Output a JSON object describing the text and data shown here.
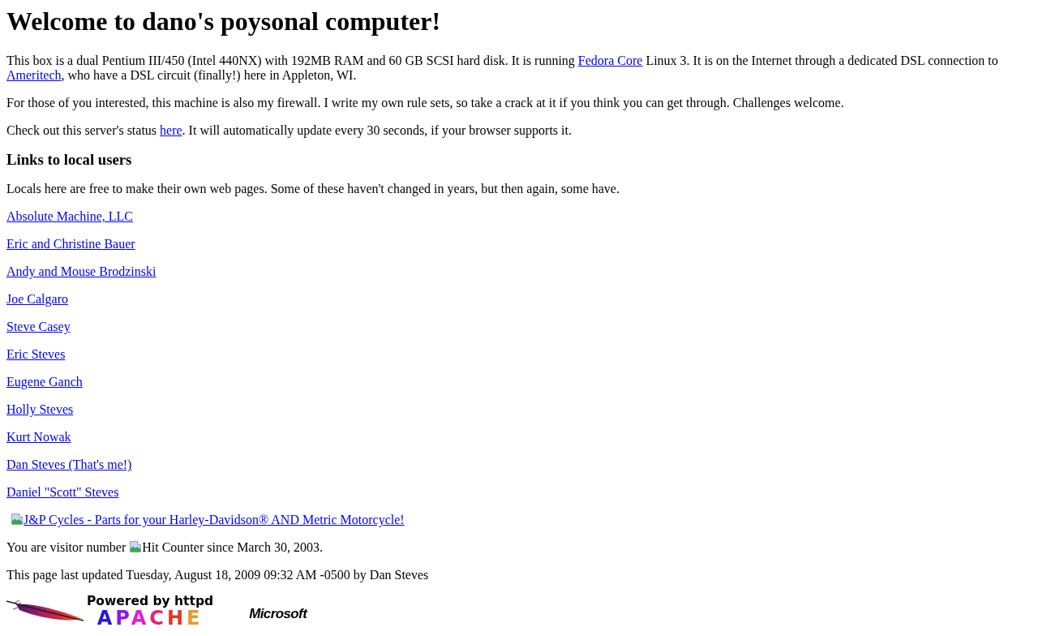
{
  "title": "Welcome to dano's poysonal computer!",
  "intro": [
    {
      "parts": [
        {
          "kind": "text",
          "text": "This box is a dual Pentium III/450 (Intel 440NX) with 192MB RAM and 60 GB SCSI hard disk. It is running "
        },
        {
          "kind": "link",
          "text": "Fedora Core"
        },
        {
          "kind": "text",
          "text": " Linux 3. It is on the Internet through a dedicated DSL connection to "
        },
        {
          "kind": "link",
          "text": "Ameritech"
        },
        {
          "kind": "text",
          "text": ", who have a DSL circuit (finally!) here in Appleton, WI."
        }
      ]
    },
    {
      "parts": [
        {
          "kind": "text",
          "text": "For those of you interested, this machine is also my firewall. I write my own rule sets, so take a crack at it if you think you can get through. Challenges welcome."
        }
      ]
    },
    {
      "parts": [
        {
          "kind": "text",
          "text": "Check out this server's status "
        },
        {
          "kind": "link",
          "text": "here"
        },
        {
          "kind": "text",
          "text": ". It will automatically update every 30 seconds, if your browser supports it."
        }
      ]
    }
  ],
  "local_users": {
    "heading": "Links to local users",
    "description": "Locals here are free to make their own web pages. Some of these haven't changed in years, but then again, some have.",
    "links": [
      "Absolute Machine, LLC",
      "Eric and Christine Bauer",
      "Andy and Mouse Brodzinski",
      "Joe Calgaro",
      "Steve Casey",
      "Eric Steves",
      "Eugene Ganch",
      "Holly Steves",
      "Kurt Nowak",
      "Dan Steves (That's me!)",
      "Daniel \"Scott\" Steves"
    ]
  },
  "sponsor_link": {
    "image_alt": "J&P Cycles - Parts for your Harley-Davidson® AND Metric Motorcycle!"
  },
  "visitor_line": [
    {
      "kind": "text",
      "text": "You are visitor number"
    },
    {
      "kind": "image",
      "alt": "Hit Counter"
    },
    {
      "kind": "text",
      "text": "since March 30, 2003."
    }
  ],
  "last_updated": "This page last updated Tuesday, August 18, 2009 09:32 AM -0500 by Dan Steves",
  "badges": [
    {
      "kind": "apache",
      "tagline": "Powered by httpd",
      "wordmark": "APACHE"
    },
    {
      "kind": "microsoft",
      "wordmark": "Microsoft"
    }
  ]
}
